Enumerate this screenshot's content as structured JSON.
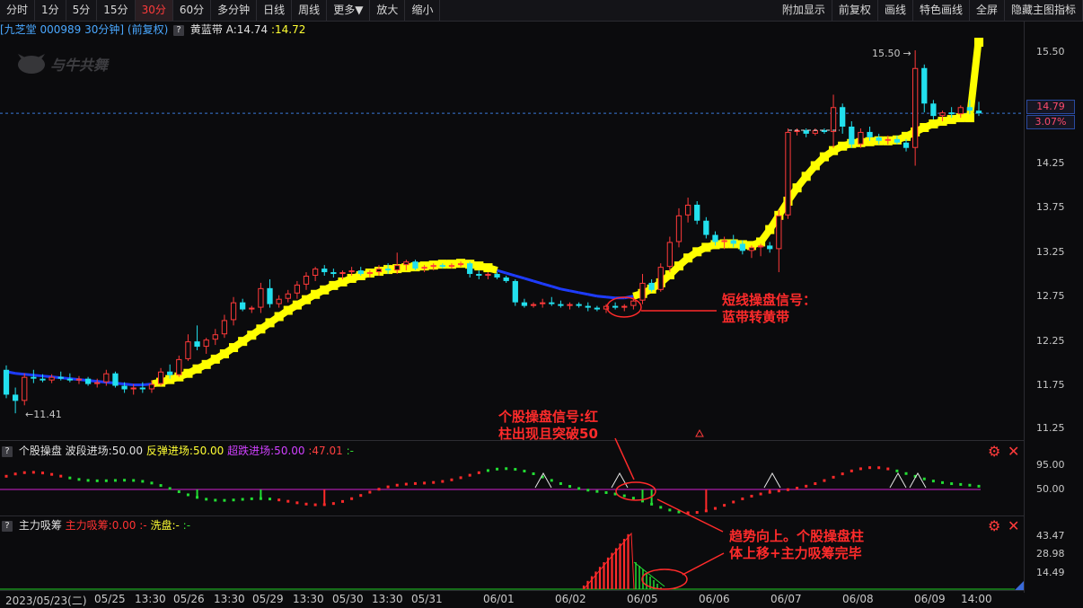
{
  "toolbar": {
    "left": [
      "分时",
      "1分",
      "5分",
      "15分",
      "30分",
      "60分",
      "多分钟",
      "日线",
      "周线",
      "更多▼",
      "放大",
      "缩小"
    ],
    "right": [
      "附加显示",
      "前复权",
      "画线",
      "特色画线",
      "全屏",
      "隐藏主图指标"
    ],
    "active": "30分"
  },
  "header": {
    "stock": "[九芝堂 000989 30分钟] (前复权)",
    "q": "?",
    "indicator": "黄蓝带",
    "a_label": "A:",
    "a_value": "14.74",
    "b_value": ":14.72",
    "logo_text": "与牛共舞"
  },
  "price_axis": {
    "ticks": [
      "15.50",
      "14.25",
      "13.75",
      "13.25",
      "12.75",
      "12.25",
      "11.75",
      "11.25"
    ],
    "current_price": "14.79",
    "change_pct": "3.07%"
  },
  "annotations": {
    "high_price": "15.50",
    "low_price": "11.41",
    "note1": [
      "短线操盘信号：",
      "蓝带转黄带"
    ],
    "note2": [
      "个股操盘信号:红",
      "柱出现且突破50"
    ],
    "note3": [
      "趋势向上。个股操盘柱",
      "体上移+主力吸筹完毕"
    ]
  },
  "indicator1": {
    "name": "个股操盘",
    "wave": "波段进场:50.00",
    "rebound": "反弹进场:50.00",
    "oversold": "超跌进场:50.00",
    "value": ":47.01",
    "tail": ":-",
    "ticks": [
      "95.00",
      "50.00"
    ]
  },
  "indicator2": {
    "name": "主力吸筹",
    "main": "主力吸筹:0.00",
    "sep": ":-",
    "wash": "洗盘:-",
    "tail": ":-",
    "ticks": [
      "43.47",
      "28.98",
      "14.49"
    ]
  },
  "xaxis": [
    "2023/05/23(二)",
    "05/25",
    "13:30",
    "05/26",
    "13:30",
    "05/29",
    "13:30",
    "05/30",
    "13:30",
    "05/31",
    "06/01",
    "06/02",
    "06/05",
    "06/06",
    "06/07",
    "06/08",
    "06/09",
    "14:00"
  ],
  "colors": {
    "up": "#ff3a3a",
    "down": "#22e0ee",
    "band_yellow": "#ffff00",
    "band_blue": "#1e3cff",
    "osc_up": "#ff2a2a",
    "osc_down": "#22dd33",
    "purple_line": "#d020d0",
    "accent_red": "#ff2b2b"
  },
  "chart_data": {
    "type": "candlestick",
    "candles_ohlc": [
      [
        11.9,
        11.95,
        11.58,
        11.62
      ],
      [
        11.62,
        11.7,
        11.41,
        11.55
      ],
      [
        11.55,
        11.86,
        11.5,
        11.82
      ],
      [
        11.82,
        11.9,
        11.75,
        11.8
      ],
      [
        11.8,
        11.85,
        11.76,
        11.78
      ],
      [
        11.78,
        11.85,
        11.75,
        11.82
      ],
      [
        11.82,
        11.88,
        11.78,
        11.8
      ],
      [
        11.8,
        11.86,
        11.76,
        11.78
      ],
      [
        11.78,
        11.83,
        11.74,
        11.8
      ],
      [
        11.8,
        11.82,
        11.72,
        11.74
      ],
      [
        11.74,
        11.8,
        11.7,
        11.76
      ],
      [
        11.76,
        11.9,
        11.72,
        11.86
      ],
      [
        11.86,
        11.88,
        11.7,
        11.72
      ],
      [
        11.72,
        11.76,
        11.64,
        11.68
      ],
      [
        11.68,
        11.74,
        11.62,
        11.7
      ],
      [
        11.7,
        11.76,
        11.64,
        11.68
      ],
      [
        11.68,
        11.78,
        11.64,
        11.74
      ],
      [
        11.74,
        11.92,
        11.72,
        11.88
      ],
      [
        11.88,
        11.96,
        11.8,
        11.84
      ],
      [
        11.84,
        12.06,
        11.82,
        12.02
      ],
      [
        12.02,
        12.3,
        12.0,
        12.22
      ],
      [
        12.22,
        12.4,
        12.12,
        12.16
      ],
      [
        12.16,
        12.26,
        12.08,
        12.24
      ],
      [
        12.24,
        12.36,
        12.18,
        12.3
      ],
      [
        12.3,
        12.52,
        12.26,
        12.46
      ],
      [
        12.46,
        12.72,
        12.4,
        12.66
      ],
      [
        12.66,
        12.7,
        12.56,
        12.58
      ],
      [
        12.58,
        12.62,
        12.54,
        12.6
      ],
      [
        12.6,
        12.88,
        12.54,
        12.82
      ],
      [
        12.82,
        12.92,
        12.6,
        12.64
      ],
      [
        12.64,
        12.74,
        12.6,
        12.7
      ],
      [
        12.7,
        12.8,
        12.66,
        12.76
      ],
      [
        12.76,
        12.9,
        12.7,
        12.86
      ],
      [
        12.86,
        13.0,
        12.8,
        12.96
      ],
      [
        12.96,
        13.06,
        12.9,
        13.04
      ],
      [
        13.04,
        13.08,
        12.96,
        13.0
      ],
      [
        13.0,
        13.04,
        12.94,
        12.98
      ],
      [
        12.98,
        13.02,
        12.92,
        13.0
      ],
      [
        13.0,
        13.06,
        12.96,
        13.02
      ],
      [
        13.02,
        13.06,
        12.96,
        12.98
      ],
      [
        12.98,
        13.02,
        12.94,
        13.0
      ],
      [
        13.0,
        13.08,
        12.96,
        13.04
      ],
      [
        13.04,
        13.1,
        12.98,
        13.02
      ],
      [
        13.02,
        13.22,
        12.98,
        13.08
      ],
      [
        13.08,
        13.14,
        13.02,
        13.12
      ],
      [
        13.12,
        13.14,
        13.02,
        13.04
      ],
      [
        13.04,
        13.08,
        13.0,
        13.06
      ],
      [
        13.06,
        13.1,
        13.02,
        13.08
      ],
      [
        13.08,
        13.1,
        13.04,
        13.06
      ],
      [
        13.06,
        13.1,
        13.04,
        13.08
      ],
      [
        13.08,
        13.12,
        13.06,
        13.1
      ],
      [
        13.1,
        13.12,
        12.94,
        12.98
      ],
      [
        12.98,
        13.02,
        12.92,
        12.96
      ],
      [
        12.96,
        13.0,
        12.92,
        12.98
      ],
      [
        12.98,
        13.0,
        12.92,
        12.94
      ],
      [
        12.94,
        12.96,
        12.88,
        12.9
      ],
      [
        12.9,
        12.92,
        12.62,
        12.66
      ],
      [
        12.66,
        12.7,
        12.6,
        12.62
      ],
      [
        12.62,
        12.66,
        12.6,
        12.64
      ],
      [
        12.64,
        12.7,
        12.6,
        12.66
      ],
      [
        12.66,
        12.72,
        12.62,
        12.64
      ],
      [
        12.64,
        12.68,
        12.6,
        12.62
      ],
      [
        12.62,
        12.66,
        12.58,
        12.64
      ],
      [
        12.64,
        12.66,
        12.6,
        12.62
      ],
      [
        12.62,
        12.66,
        12.56,
        12.6
      ],
      [
        12.6,
        12.62,
        12.56,
        12.58
      ],
      [
        12.58,
        12.64,
        12.54,
        12.62
      ],
      [
        12.62,
        12.66,
        12.58,
        12.6
      ],
      [
        12.6,
        12.64,
        12.56,
        12.62
      ],
      [
        12.62,
        12.72,
        12.58,
        12.68
      ],
      [
        12.68,
        12.98,
        12.64,
        12.88
      ],
      [
        12.88,
        12.92,
        12.78,
        12.8
      ],
      [
        12.8,
        13.1,
        12.78,
        13.06
      ],
      [
        13.06,
        13.4,
        13.0,
        13.34
      ],
      [
        13.34,
        13.72,
        13.28,
        13.64
      ],
      [
        13.64,
        13.84,
        13.56,
        13.76
      ],
      [
        13.76,
        13.8,
        13.54,
        13.58
      ],
      [
        13.58,
        13.62,
        13.38,
        13.42
      ],
      [
        13.42,
        13.46,
        13.3,
        13.34
      ],
      [
        13.34,
        13.4,
        13.26,
        13.36
      ],
      [
        13.36,
        13.42,
        13.28,
        13.32
      ],
      [
        13.32,
        13.36,
        13.2,
        13.24
      ],
      [
        13.24,
        13.3,
        13.16,
        13.28
      ],
      [
        13.28,
        13.32,
        13.18,
        13.3
      ],
      [
        13.3,
        13.34,
        13.22,
        13.26
      ],
      [
        13.26,
        13.7,
        13.0,
        13.64
      ],
      [
        13.64,
        14.62,
        13.6,
        14.58
      ],
      [
        14.58,
        14.62,
        14.54,
        14.6
      ],
      [
        14.6,
        14.62,
        14.52,
        14.56
      ],
      [
        14.56,
        14.62,
        14.54,
        14.6
      ],
      [
        14.6,
        14.62,
        14.56,
        14.58
      ],
      [
        14.58,
        15.0,
        14.4,
        14.86
      ],
      [
        14.86,
        14.9,
        14.56,
        14.64
      ],
      [
        14.64,
        14.7,
        14.4,
        14.44
      ],
      [
        14.44,
        14.62,
        14.4,
        14.58
      ],
      [
        14.58,
        14.64,
        14.48,
        14.52
      ],
      [
        14.52,
        14.56,
        14.44,
        14.48
      ],
      [
        14.48,
        14.54,
        14.44,
        14.5
      ],
      [
        14.5,
        14.54,
        14.44,
        14.46
      ],
      [
        14.46,
        14.5,
        14.36,
        14.4
      ],
      [
        14.4,
        15.5,
        14.2,
        15.3
      ],
      [
        15.3,
        15.34,
        14.8,
        14.9
      ],
      [
        14.9,
        14.94,
        14.72,
        14.76
      ],
      [
        14.76,
        14.82,
        14.7,
        14.8
      ],
      [
        14.8,
        14.86,
        14.74,
        14.78
      ],
      [
        14.78,
        14.88,
        14.74,
        14.86
      ],
      [
        14.86,
        14.94,
        14.78,
        14.82
      ],
      [
        14.82,
        14.92,
        14.76,
        14.79
      ]
    ],
    "band": [
      11.88,
      11.86,
      11.85,
      11.84,
      11.83,
      11.82,
      11.81,
      11.8,
      11.79,
      11.78,
      11.77,
      11.76,
      11.75,
      11.74,
      11.73,
      11.73,
      11.74,
      11.76,
      11.79,
      11.82,
      11.86,
      11.91,
      11.96,
      12.02,
      12.08,
      12.15,
      12.22,
      12.29,
      12.36,
      12.43,
      12.5,
      12.57,
      12.63,
      12.69,
      12.75,
      12.8,
      12.85,
      12.89,
      12.93,
      12.96,
      12.99,
      13.01,
      13.03,
      13.04,
      13.05,
      13.06,
      13.07,
      13.08,
      13.09,
      13.09,
      13.1,
      13.09,
      13.07,
      13.05,
      13.02,
      12.99,
      12.96,
      12.93,
      12.9,
      12.87,
      12.84,
      12.81,
      12.79,
      12.77,
      12.75,
      12.73,
      12.72,
      12.71,
      12.71,
      12.73,
      12.76,
      12.81,
      12.88,
      12.97,
      13.07,
      13.16,
      13.23,
      13.28,
      13.31,
      13.32,
      13.32,
      13.31,
      13.3,
      13.34,
      13.48,
      13.64,
      13.8,
      13.95,
      14.08,
      14.2,
      14.3,
      14.37,
      14.42,
      14.45,
      14.46,
      14.47,
      14.48,
      14.48,
      14.49,
      14.53,
      14.58,
      14.63,
      14.67,
      14.7,
      14.72,
      14.74,
      14.74
    ],
    "band_blue_ranges": [
      [
        0,
        16
      ],
      [
        54,
        69
      ]
    ],
    "ylim": [
      11.1,
      15.75
    ]
  }
}
